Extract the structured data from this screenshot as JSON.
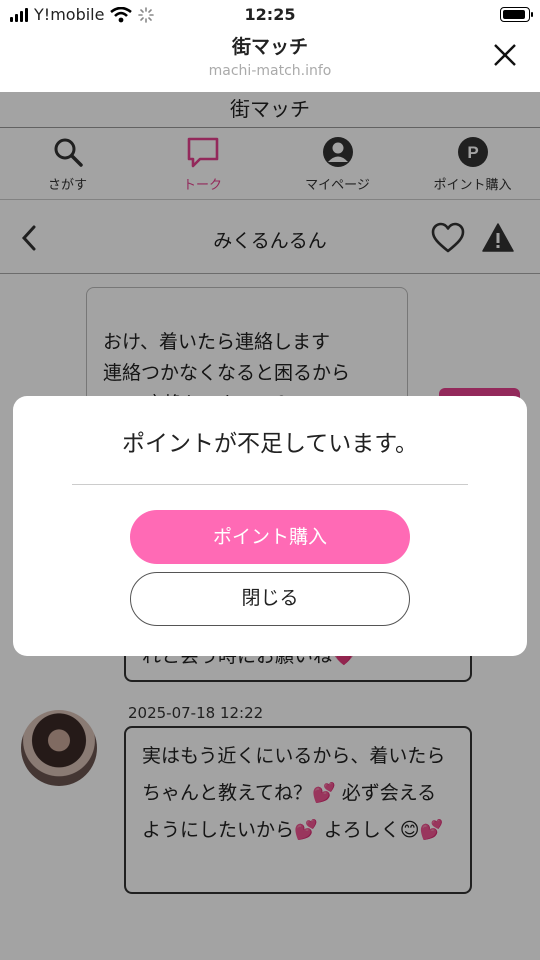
{
  "status_bar": {
    "carrier": "Y!mobile",
    "time": "12:25"
  },
  "browser": {
    "title": "街マッチ",
    "url": "machi-match.info"
  },
  "app": {
    "title": "街マッチ",
    "tabs": [
      {
        "label": "さがす",
        "icon": "search-icon"
      },
      {
        "label": "トーク",
        "icon": "chat-icon",
        "active": true
      },
      {
        "label": "マイページ",
        "icon": "user-icon"
      },
      {
        "label": "ポイント購入",
        "icon": "point-icon"
      }
    ]
  },
  "chat": {
    "partner_name": "みくるんるん",
    "messages": [
      {
        "text": "おけ、着いたら連絡します\n連絡つかなくなると困るから\nLINE交換してもいい？\nhttps://line.me/ti/p/mC8a7R"
      },
      {
        "text": "れと会う時にお願いね💗"
      },
      {
        "timestamp": "2025-07-18 12:22",
        "text": "実はもう近くにいるから、着いたらちゃんと教えてね？💕 必ず会えるようにしたいから💕 よろしく😊💕"
      }
    ]
  },
  "dialog": {
    "message": "ポイントが不足しています。",
    "buy_label": "ポイント購入",
    "close_label": "閉じる"
  },
  "colors": {
    "accent": "#e6418f",
    "button_pink": "#ff6ab5"
  }
}
